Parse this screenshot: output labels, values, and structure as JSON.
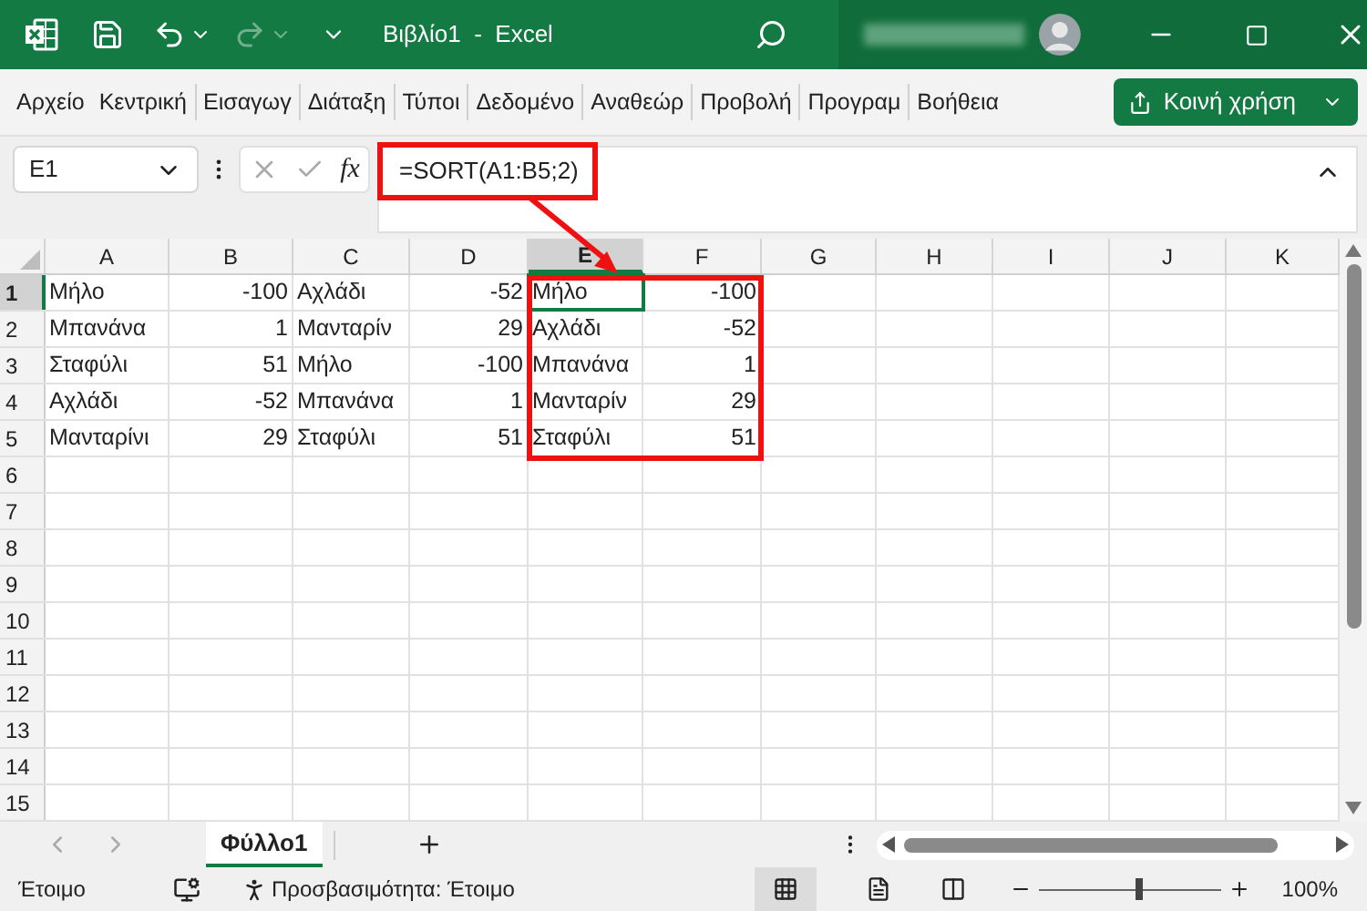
{
  "window": {
    "title": "Βιβλίο1  -  Excel",
    "redo_disabled": true
  },
  "ribbon_tabs": [
    {
      "label": "Αρχείο"
    },
    {
      "label": "Κεντρική"
    },
    {
      "label": "Εισαγωγ"
    },
    {
      "label": "Διάταξη"
    },
    {
      "label": "Τύποι"
    },
    {
      "label": "Δεδομένο"
    },
    {
      "label": "Αναθεώρ"
    },
    {
      "label": "Προβολή"
    },
    {
      "label": "Προγραμ"
    },
    {
      "label": "Βοήθεια"
    }
  ],
  "share_button": {
    "label": "Κοινή χρήση"
  },
  "name_box": {
    "value": "E1"
  },
  "function_button": {
    "label": "fx"
  },
  "formula": {
    "value": "=SORT(A1:B5;2)"
  },
  "columns": [
    {
      "label": "A",
      "selected": false
    },
    {
      "label": "B",
      "selected": false
    },
    {
      "label": "C",
      "selected": false
    },
    {
      "label": "D",
      "selected": false
    },
    {
      "label": "E",
      "selected": true
    },
    {
      "label": "F",
      "selected": false
    },
    {
      "label": "G",
      "selected": false
    },
    {
      "label": "H",
      "selected": false
    },
    {
      "label": "I",
      "selected": false
    },
    {
      "label": "J",
      "selected": false
    },
    {
      "label": "K",
      "selected": false
    }
  ],
  "rows": [
    {
      "number": "1",
      "selected": true,
      "cells": [
        {
          "text": "Μήλο",
          "kind": "text"
        },
        {
          "text": "-100",
          "kind": "number"
        },
        {
          "text": "Αχλάδι",
          "kind": "text"
        },
        {
          "text": "-52",
          "kind": "number"
        },
        {
          "text": "Μήλο",
          "kind": "text"
        },
        {
          "text": "-100",
          "kind": "number"
        }
      ]
    },
    {
      "number": "2",
      "selected": false,
      "cells": [
        {
          "text": "Μπανάνα",
          "kind": "text"
        },
        {
          "text": "1",
          "kind": "number"
        },
        {
          "text": "Μανταρίν",
          "kind": "text"
        },
        {
          "text": "29",
          "kind": "number"
        },
        {
          "text": "Αχλάδι",
          "kind": "text"
        },
        {
          "text": "-52",
          "kind": "number"
        }
      ]
    },
    {
      "number": "3",
      "selected": false,
      "cells": [
        {
          "text": "Σταφύλι",
          "kind": "text"
        },
        {
          "text": "51",
          "kind": "number"
        },
        {
          "text": "Μήλο",
          "kind": "text"
        },
        {
          "text": "-100",
          "kind": "number"
        },
        {
          "text": "Μπανάνα",
          "kind": "text"
        },
        {
          "text": "1",
          "kind": "number"
        }
      ]
    },
    {
      "number": "4",
      "selected": false,
      "cells": [
        {
          "text": "Αχλάδι",
          "kind": "text"
        },
        {
          "text": "-52",
          "kind": "number"
        },
        {
          "text": "Μπανάνα",
          "kind": "text"
        },
        {
          "text": "1",
          "kind": "number"
        },
        {
          "text": "Μανταρίν",
          "kind": "text"
        },
        {
          "text": "29",
          "kind": "number"
        }
      ]
    },
    {
      "number": "5",
      "selected": false,
      "cells": [
        {
          "text": "Μανταρίνι",
          "kind": "text"
        },
        {
          "text": "29",
          "kind": "number"
        },
        {
          "text": "Σταφύλι",
          "kind": "text"
        },
        {
          "text": "51",
          "kind": "number"
        },
        {
          "text": "Σταφύλι",
          "kind": "text"
        },
        {
          "text": "51",
          "kind": "number"
        }
      ]
    },
    {
      "number": "6",
      "selected": false
    },
    {
      "number": "7",
      "selected": false
    },
    {
      "number": "8",
      "selected": false
    },
    {
      "number": "9",
      "selected": false
    },
    {
      "number": "10",
      "selected": false
    },
    {
      "number": "11",
      "selected": false
    },
    {
      "number": "12",
      "selected": false
    },
    {
      "number": "13",
      "selected": false
    },
    {
      "number": "14",
      "selected": false
    },
    {
      "number": "15",
      "selected": false
    }
  ],
  "sheet_tabs": [
    {
      "label": "Φύλλο1",
      "selected": true
    }
  ],
  "status_bar": {
    "status": "Έτοιμο",
    "accessibility": "Προσβασιμότητα: Έτοιμο",
    "zoom": {
      "level": 0.55,
      "reading": "100%"
    }
  }
}
